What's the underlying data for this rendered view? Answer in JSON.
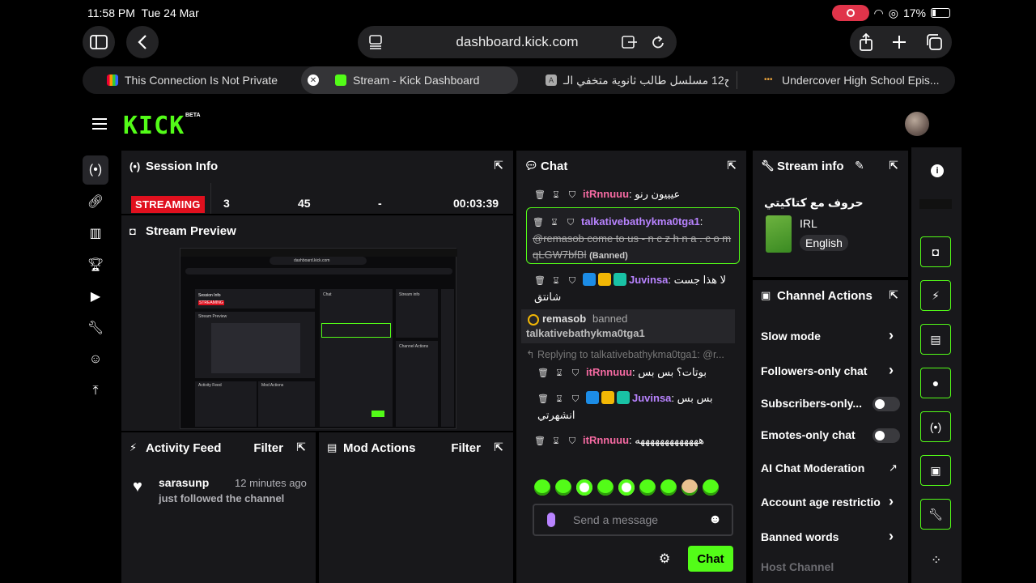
{
  "status_bar": {
    "time": "11:58 PM",
    "date": "Tue 24 Mar",
    "battery": "17%"
  },
  "browser": {
    "url": "dashboard.kick.com",
    "tabs": [
      {
        "title": "This Connection Is Not Private"
      },
      {
        "title": "Stream - Kick Dashboard",
        "active": true
      },
      {
        "title": "ح12 مسلسل طالب ثانوية متخفي الـ"
      },
      {
        "title": "Undercover High School Epis..."
      }
    ]
  },
  "app": {
    "logo": "KICK",
    "beta": "BETA"
  },
  "session_info": {
    "title": "Session Info",
    "status": "STREAMING",
    "stats": [
      "3",
      "45",
      "-",
      "00:03:39"
    ]
  },
  "stream_preview": {
    "title": "Stream Preview"
  },
  "activity_feed": {
    "title": "Activity Feed",
    "filter": "Filter",
    "items": [
      {
        "user": "sarasunp",
        "time": "12 minutes ago",
        "text": "just followed the channel"
      }
    ]
  },
  "mod_actions": {
    "title": "Mod Actions",
    "filter": "Filter"
  },
  "chat": {
    "title": "Chat",
    "messages": [
      {
        "user": "itRnnuuu",
        "text": "عيييون رنو"
      },
      {
        "user": "talkativebathykma0tga1",
        "text": "@remasob come to us - n c z h n a . c o m qLGW7bfBl",
        "note": "(Banned)"
      },
      {
        "user": "Juvinsa",
        "text": "لا هذا جست شانتق"
      },
      {
        "user": "remasob",
        "action": "banned",
        "target": "talkativebathykma0tga1"
      },
      {
        "reply": "Replying to talkativebathykma0tga1: @r..."
      },
      {
        "user": "itRnnuuu",
        "text": "بوتات؟ بس بس"
      },
      {
        "user": "Juvinsa",
        "text": "بس بس انشهرتي"
      },
      {
        "user": "itRnnuuu",
        "text": "هههههههههههههه"
      }
    ],
    "input_placeholder": "Send a message",
    "send_label": "Chat"
  },
  "stream_info": {
    "title": "Stream info",
    "stream_title": "حروف مع كتاكيتي",
    "category": "IRL",
    "language": "English"
  },
  "channel_actions": {
    "title": "Channel Actions",
    "items": [
      {
        "label": "Slow mode"
      },
      {
        "label": "Followers-only chat"
      },
      {
        "label": "Subscribers-only..."
      },
      {
        "label": "Emotes-only chat"
      },
      {
        "label": "AI Chat Moderation"
      },
      {
        "label": "Account age restrictio"
      },
      {
        "label": "Banned words"
      },
      {
        "label": "Host Channel"
      }
    ]
  },
  "colors": {
    "kick_green": "#53fc18",
    "panel": "#18181b",
    "streaming_red": "#e0101e",
    "username_pink": "#f56aa2",
    "username_purple": "#b883ff"
  }
}
